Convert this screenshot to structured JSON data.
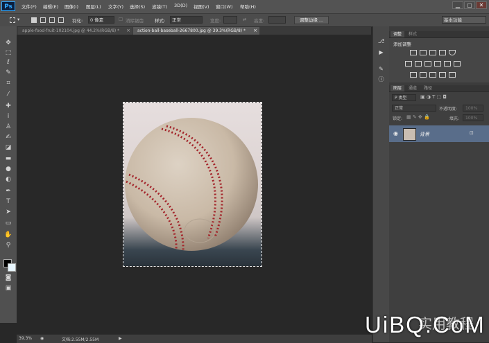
{
  "app": {
    "logo": "Ps"
  },
  "menu": [
    "文件(F)",
    "编辑(E)",
    "图像(I)",
    "图层(L)",
    "文字(Y)",
    "选择(S)",
    "滤镜(T)",
    "3D(D)",
    "视图(V)",
    "窗口(W)",
    "帮助(H)"
  ],
  "window_controls": {
    "minimize": "▁",
    "maximize": "▢",
    "close": "✕"
  },
  "options": {
    "feather_label": "羽化:",
    "feather_value": "0 像素",
    "antialias_label": "消除锯齿",
    "style_label": "样式:",
    "style_value": "正常",
    "width_label": "宽度:",
    "height_label": "高度:",
    "refine_edge_button": "调整边缘 ...",
    "workspace": "基本功能"
  },
  "tabs": [
    {
      "label": "apple-food-fruit-102104.jpg @ 44.2%(RGB/8) *",
      "close": "×",
      "active": false
    },
    {
      "label": "action-ball-baseball-2667800.jpg @ 39.3%(RGB/8) *",
      "close": "×",
      "active": true
    }
  ],
  "tools": [
    "move-tool",
    "marquee-tool",
    "lasso-tool",
    "quick-select-tool",
    "crop-tool",
    "eyedropper-tool",
    "healing-tool",
    "brush-tool",
    "stamp-tool",
    "history-brush-tool",
    "eraser-tool",
    "gradient-tool",
    "blur-tool",
    "dodge-tool",
    "pen-tool",
    "type-tool",
    "path-select-tool",
    "shape-tool",
    "hand-tool",
    "zoom-tool"
  ],
  "status": {
    "zoom": "39.3%",
    "doc": "文档:2.55M/2.55M"
  },
  "adjustments_panel": {
    "tabs": [
      "调整",
      "样式"
    ],
    "title": "添加调整"
  },
  "layers_panel": {
    "tabs": [
      "图层",
      "通道",
      "路径"
    ],
    "filter_kind": "P 类型",
    "blend_mode": "正常",
    "opacity_label": "不透明度:",
    "opacity_value": "100%",
    "lock_label": "锁定:",
    "fill_label": "填充:",
    "fill_value": "100%",
    "layers": [
      {
        "name": "背景",
        "visible": true,
        "locked": true
      }
    ]
  },
  "watermark": {
    "text": "UiBQ.CoM",
    "cn": "实用教程"
  }
}
